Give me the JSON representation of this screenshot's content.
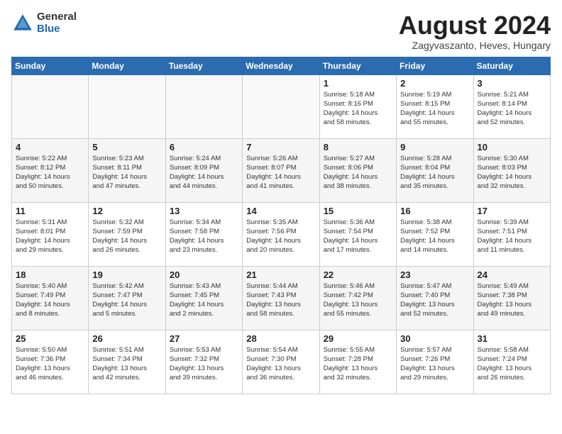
{
  "header": {
    "logo_general": "General",
    "logo_blue": "Blue",
    "month_year": "August 2024",
    "location": "Zagyvaszanto, Heves, Hungary"
  },
  "days_of_week": [
    "Sunday",
    "Monday",
    "Tuesday",
    "Wednesday",
    "Thursday",
    "Friday",
    "Saturday"
  ],
  "weeks": [
    [
      {
        "day": "",
        "info": ""
      },
      {
        "day": "",
        "info": ""
      },
      {
        "day": "",
        "info": ""
      },
      {
        "day": "",
        "info": ""
      },
      {
        "day": "1",
        "info": "Sunrise: 5:18 AM\nSunset: 8:16 PM\nDaylight: 14 hours\nand 58 minutes."
      },
      {
        "day": "2",
        "info": "Sunrise: 5:19 AM\nSunset: 8:15 PM\nDaylight: 14 hours\nand 55 minutes."
      },
      {
        "day": "3",
        "info": "Sunrise: 5:21 AM\nSunset: 8:14 PM\nDaylight: 14 hours\nand 52 minutes."
      }
    ],
    [
      {
        "day": "4",
        "info": "Sunrise: 5:22 AM\nSunset: 8:12 PM\nDaylight: 14 hours\nand 50 minutes."
      },
      {
        "day": "5",
        "info": "Sunrise: 5:23 AM\nSunset: 8:11 PM\nDaylight: 14 hours\nand 47 minutes."
      },
      {
        "day": "6",
        "info": "Sunrise: 5:24 AM\nSunset: 8:09 PM\nDaylight: 14 hours\nand 44 minutes."
      },
      {
        "day": "7",
        "info": "Sunrise: 5:26 AM\nSunset: 8:07 PM\nDaylight: 14 hours\nand 41 minutes."
      },
      {
        "day": "8",
        "info": "Sunrise: 5:27 AM\nSunset: 8:06 PM\nDaylight: 14 hours\nand 38 minutes."
      },
      {
        "day": "9",
        "info": "Sunrise: 5:28 AM\nSunset: 8:04 PM\nDaylight: 14 hours\nand 35 minutes."
      },
      {
        "day": "10",
        "info": "Sunrise: 5:30 AM\nSunset: 8:03 PM\nDaylight: 14 hours\nand 32 minutes."
      }
    ],
    [
      {
        "day": "11",
        "info": "Sunrise: 5:31 AM\nSunset: 8:01 PM\nDaylight: 14 hours\nand 29 minutes."
      },
      {
        "day": "12",
        "info": "Sunrise: 5:32 AM\nSunset: 7:59 PM\nDaylight: 14 hours\nand 26 minutes."
      },
      {
        "day": "13",
        "info": "Sunrise: 5:34 AM\nSunset: 7:58 PM\nDaylight: 14 hours\nand 23 minutes."
      },
      {
        "day": "14",
        "info": "Sunrise: 5:35 AM\nSunset: 7:56 PM\nDaylight: 14 hours\nand 20 minutes."
      },
      {
        "day": "15",
        "info": "Sunrise: 5:36 AM\nSunset: 7:54 PM\nDaylight: 14 hours\nand 17 minutes."
      },
      {
        "day": "16",
        "info": "Sunrise: 5:38 AM\nSunset: 7:52 PM\nDaylight: 14 hours\nand 14 minutes."
      },
      {
        "day": "17",
        "info": "Sunrise: 5:39 AM\nSunset: 7:51 PM\nDaylight: 14 hours\nand 11 minutes."
      }
    ],
    [
      {
        "day": "18",
        "info": "Sunrise: 5:40 AM\nSunset: 7:49 PM\nDaylight: 14 hours\nand 8 minutes."
      },
      {
        "day": "19",
        "info": "Sunrise: 5:42 AM\nSunset: 7:47 PM\nDaylight: 14 hours\nand 5 minutes."
      },
      {
        "day": "20",
        "info": "Sunrise: 5:43 AM\nSunset: 7:45 PM\nDaylight: 14 hours\nand 2 minutes."
      },
      {
        "day": "21",
        "info": "Sunrise: 5:44 AM\nSunset: 7:43 PM\nDaylight: 13 hours\nand 58 minutes."
      },
      {
        "day": "22",
        "info": "Sunrise: 5:46 AM\nSunset: 7:42 PM\nDaylight: 13 hours\nand 55 minutes."
      },
      {
        "day": "23",
        "info": "Sunrise: 5:47 AM\nSunset: 7:40 PM\nDaylight: 13 hours\nand 52 minutes."
      },
      {
        "day": "24",
        "info": "Sunrise: 5:49 AM\nSunset: 7:38 PM\nDaylight: 13 hours\nand 49 minutes."
      }
    ],
    [
      {
        "day": "25",
        "info": "Sunrise: 5:50 AM\nSunset: 7:36 PM\nDaylight: 13 hours\nand 46 minutes."
      },
      {
        "day": "26",
        "info": "Sunrise: 5:51 AM\nSunset: 7:34 PM\nDaylight: 13 hours\nand 42 minutes."
      },
      {
        "day": "27",
        "info": "Sunrise: 5:53 AM\nSunset: 7:32 PM\nDaylight: 13 hours\nand 39 minutes."
      },
      {
        "day": "28",
        "info": "Sunrise: 5:54 AM\nSunset: 7:30 PM\nDaylight: 13 hours\nand 36 minutes."
      },
      {
        "day": "29",
        "info": "Sunrise: 5:55 AM\nSunset: 7:28 PM\nDaylight: 13 hours\nand 32 minutes."
      },
      {
        "day": "30",
        "info": "Sunrise: 5:57 AM\nSunset: 7:26 PM\nDaylight: 13 hours\nand 29 minutes."
      },
      {
        "day": "31",
        "info": "Sunrise: 5:58 AM\nSunset: 7:24 PM\nDaylight: 13 hours\nand 26 minutes."
      }
    ]
  ]
}
